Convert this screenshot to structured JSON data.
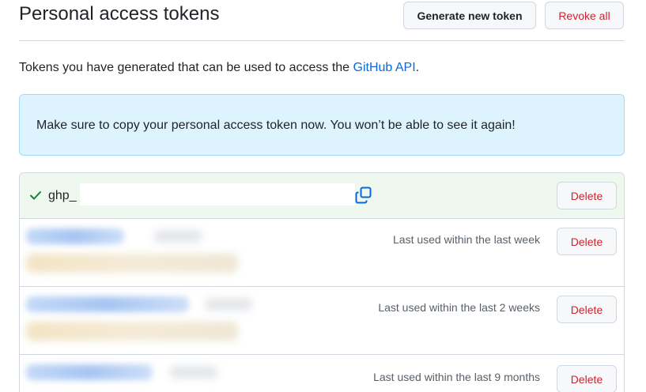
{
  "header": {
    "title": "Personal access tokens",
    "generate_label": "Generate new token",
    "revoke_label": "Revoke all"
  },
  "description": {
    "text": "Tokens you have generated that can be used to access the ",
    "link": "GitHub API",
    "suffix": "."
  },
  "flash": {
    "message": "Make sure to copy your personal access token now. You won’t be able to see it again!"
  },
  "tokens": {
    "new_token": {
      "prefix": "ghp_",
      "delete_label": "Delete",
      "icons": [
        "check-icon",
        "copy-icon"
      ]
    },
    "list": [
      {
        "last_used": "Last used within the last week",
        "delete_label": "Delete"
      },
      {
        "last_used": "Last used within the last 2 weeks",
        "delete_label": "Delete"
      },
      {
        "last_used": "Last used within the last 9 months",
        "delete_label": "Delete"
      }
    ]
  },
  "colors": {
    "danger": "#cf222e",
    "link": "#0969da",
    "flash_bg": "#ddf4ff",
    "success_bg": "#eef8ee",
    "success": "#1a7f37"
  }
}
